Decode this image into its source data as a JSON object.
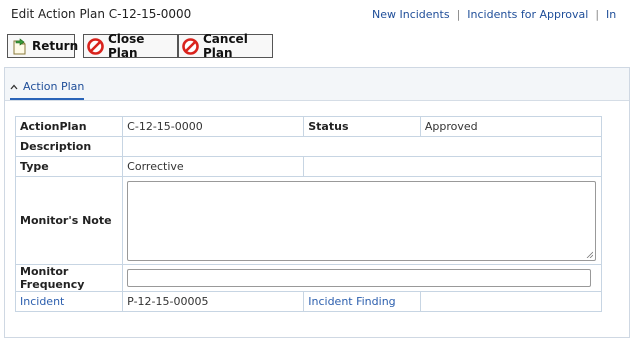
{
  "header": {
    "title": "Edit Action Plan C-12-15-0000",
    "nav": {
      "new_incidents": "New Incidents",
      "incidents_for_approval": "Incidents for Approval",
      "separator": "|",
      "truncated_link": "In"
    }
  },
  "toolbar": {
    "return_label": "Return",
    "close_plan_label": "Close Plan",
    "cancel_plan_label": "Cancel Plan"
  },
  "panel": {
    "tab_label": "Action Plan"
  },
  "form": {
    "action_plan_label": "ActionPlan",
    "action_plan_value": "C-12-15-0000",
    "status_label": "Status",
    "status_value": "Approved",
    "description_label": "Description",
    "description_value": "",
    "type_label": "Type",
    "type_value": "Corrective",
    "monitors_note_label": "Monitor's Note",
    "monitors_note_value": "",
    "monitor_frequency_label": "Monitor Frequency",
    "monitor_frequency_value": "",
    "incident_label": "Incident",
    "incident_value": "P-12-15-00005",
    "incident_finding_label": "Incident Finding",
    "incident_finding_value": ""
  },
  "colors": {
    "link": "#1f4e99",
    "no_icon_red": "#d9231d",
    "table_border": "#c7d5e3"
  },
  "icons": {
    "return": "return-doc-icon",
    "close_plan": "no-entry-icon",
    "cancel_plan": "no-entry-icon",
    "tab": "chevron-up-icon"
  }
}
